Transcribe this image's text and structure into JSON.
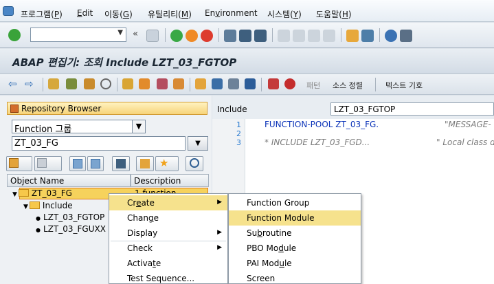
{
  "menu": {
    "items": [
      {
        "label": "프로그램(",
        "key": "P",
        "suffix": ")"
      },
      {
        "label": "",
        "key": "E",
        "suffix": "dit"
      },
      {
        "label": "이동(",
        "key": "G",
        "suffix": ")"
      },
      {
        "label": "유틸리티(",
        "key": "M",
        "suffix": ")"
      },
      {
        "label": "En",
        "key": "v",
        "suffix": "ironment"
      },
      {
        "label": "시스템(",
        "key": "Y",
        "suffix": ")"
      },
      {
        "label": "도움말(",
        "key": "H",
        "suffix": ")"
      }
    ]
  },
  "title": "ABAP 편집기: 조회 Include LZT_03_FGTOP",
  "app_toolbar": {
    "pattern_label": "패턴",
    "sort_label": "소스 정렬",
    "text_symbol_label": "텍스트 기호"
  },
  "left": {
    "repository_browser": "Repository Browser",
    "object_type": "Function 그룹",
    "object_name": "ZT_03_FG",
    "columns": [
      "Object Name",
      "Description"
    ],
    "tree": {
      "root": "ZT_03_FG",
      "root_desc": "1 function",
      "folder": "Include",
      "children": [
        "LZT_03_FGTOP",
        "LZT_03_FGUXX"
      ]
    }
  },
  "right": {
    "include_label": "Include",
    "include_value": "LZT_03_FGTOP",
    "lines": [
      {
        "n": "1",
        "code": "FUNCTION-POOL ZT_03_FG.",
        "comment": "\"MESSAGE-"
      },
      {
        "n": "2",
        "code": "",
        "comment": ""
      },
      {
        "n": "3",
        "code": "* INCLUDE LZT_03_FGD...",
        "comment": "\" Local class d"
      }
    ]
  },
  "context_menu": {
    "items": [
      {
        "pre": "Cr",
        "key": "e",
        "post": "ate",
        "submenu": true
      },
      {
        "pre": "Chan",
        "key": "g",
        "post": "e",
        "submenu": false
      },
      {
        "pre": "Display",
        "key": "",
        "post": "",
        "submenu": true
      },
      {
        "pre": "Check",
        "key": "",
        "post": "",
        "submenu": true
      },
      {
        "pre": "Activa",
        "key": "t",
        "post": "e",
        "submenu": false
      },
      {
        "pre": "Test Sequence...",
        "key": "",
        "post": "",
        "submenu": false
      }
    ]
  },
  "submenu": {
    "items": [
      {
        "pre": "Function Group",
        "key": "",
        "post": ""
      },
      {
        "pre": "Function Module",
        "key": "",
        "post": ""
      },
      {
        "pre": "Su",
        "key": "b",
        "post": "routine"
      },
      {
        "pre": "PBO Mo",
        "key": "d",
        "post": "ule"
      },
      {
        "pre": "PAI Mod",
        "key": "u",
        "post": "le"
      },
      {
        "pre": "Screen",
        "key": "",
        "post": ""
      }
    ]
  },
  "colors": {
    "highlight": "#f6e28d",
    "selection": "#f6d25c",
    "keyword": "#0a32b8",
    "line_number": "#2a7bd0"
  }
}
